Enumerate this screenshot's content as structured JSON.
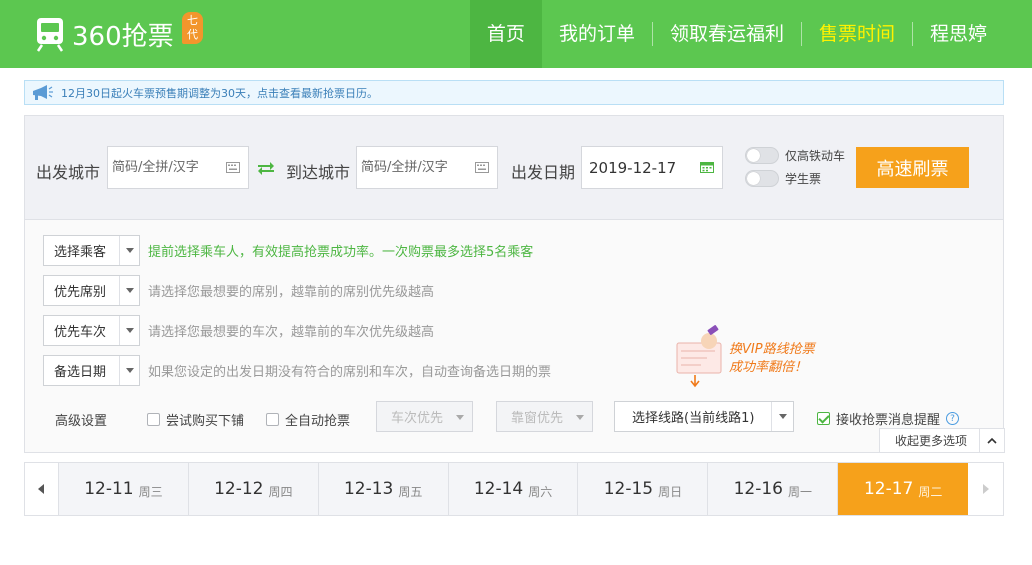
{
  "header": {
    "logo_text": "360抢票",
    "logo_badge": "七代",
    "nav": [
      {
        "label": "首页",
        "active": true
      },
      {
        "label": "我的订单"
      },
      {
        "label": "领取春运福利"
      },
      {
        "label": "售票时间",
        "highlight": true
      },
      {
        "label": "程思婷"
      }
    ]
  },
  "notice": {
    "text": "12月30日起火车票预售期调整为30天，点击查看最新抢票日历。"
  },
  "search": {
    "from_label": "出发城市",
    "from_placeholder": "简码/全拼/汉字",
    "to_label": "到达城市",
    "to_placeholder": "简码/全拼/汉字",
    "date_label": "出发日期",
    "date_value": "2019-12-17",
    "toggle_gd": "仅高铁动车",
    "toggle_student": "学生票",
    "submit": "高速刷票"
  },
  "options": {
    "rows": [
      {
        "select": "选择乘客",
        "hint": "提前选择乘车人，有效提高抢票成功率。一次购票最多选择5名乘客",
        "green": true
      },
      {
        "select": "优先席别",
        "hint": "请选择您最想要的席别，越靠前的席别优先级越高"
      },
      {
        "select": "优先车次",
        "hint": "请选择您最想要的车次，越靠前的车次优先级越高"
      },
      {
        "select": "备选日期",
        "hint": "如果您设定的出发日期没有符合的席别和车次，自动查询备选日期的票"
      }
    ],
    "advanced_label": "高级设置",
    "try_lower": "尝试购买下铺",
    "auto_grab": "全自动抢票",
    "train_priority": "车次优先",
    "window_priority": "靠窗优先",
    "route": "选择线路(当前线路1)",
    "remind": "接收抢票消息提醒",
    "remind_checked": true,
    "collapse": "收起更多选项",
    "vip_line1": "换VIP路线抢票",
    "vip_line2": "成功率翻倍！"
  },
  "dates": [
    {
      "date": "12-11",
      "week": "周三"
    },
    {
      "date": "12-12",
      "week": "周四"
    },
    {
      "date": "12-13",
      "week": "周五"
    },
    {
      "date": "12-14",
      "week": "周六"
    },
    {
      "date": "12-15",
      "week": "周日"
    },
    {
      "date": "12-16",
      "week": "周一"
    },
    {
      "date": "12-17",
      "week": "周二",
      "active": true
    }
  ],
  "colors": {
    "brand_green": "#5cc750",
    "accent_orange": "#f6a11b",
    "highlight_yellow": "#fff200"
  }
}
